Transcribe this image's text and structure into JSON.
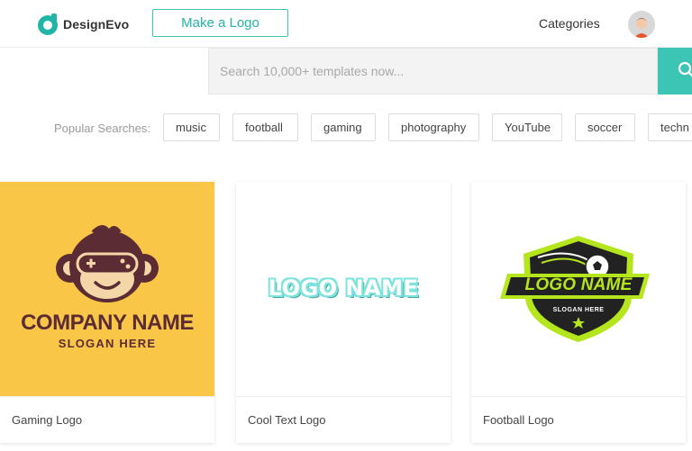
{
  "header": {
    "brand": "DesignEvo",
    "make_logo_label": "Make a Logo",
    "categories_label": "Categories"
  },
  "search": {
    "placeholder": "Search 10,000+ templates now...",
    "value": ""
  },
  "popular": {
    "label": "Popular Searches:",
    "chips": [
      "music",
      "football",
      "gaming",
      "photography",
      "YouTube",
      "soccer",
      "techn"
    ]
  },
  "cards": [
    {
      "caption": "Gaming Logo",
      "company_text": "COMPANY NAME",
      "slogan_text": "SLOGAN HERE",
      "bg_color": "#f9c647",
      "accent_color": "#5b2c33"
    },
    {
      "caption": "Cool Text Logo",
      "logo_text": "LOGO NAME",
      "accent_color": "#7fe3dd"
    },
    {
      "caption": "Football Logo",
      "logo_text": "LOGO NAME",
      "slogan_text": "SLOGAN HERE",
      "accent_color": "#b5e51d"
    }
  ],
  "colors": {
    "brand_teal": "#3cc4b4"
  }
}
